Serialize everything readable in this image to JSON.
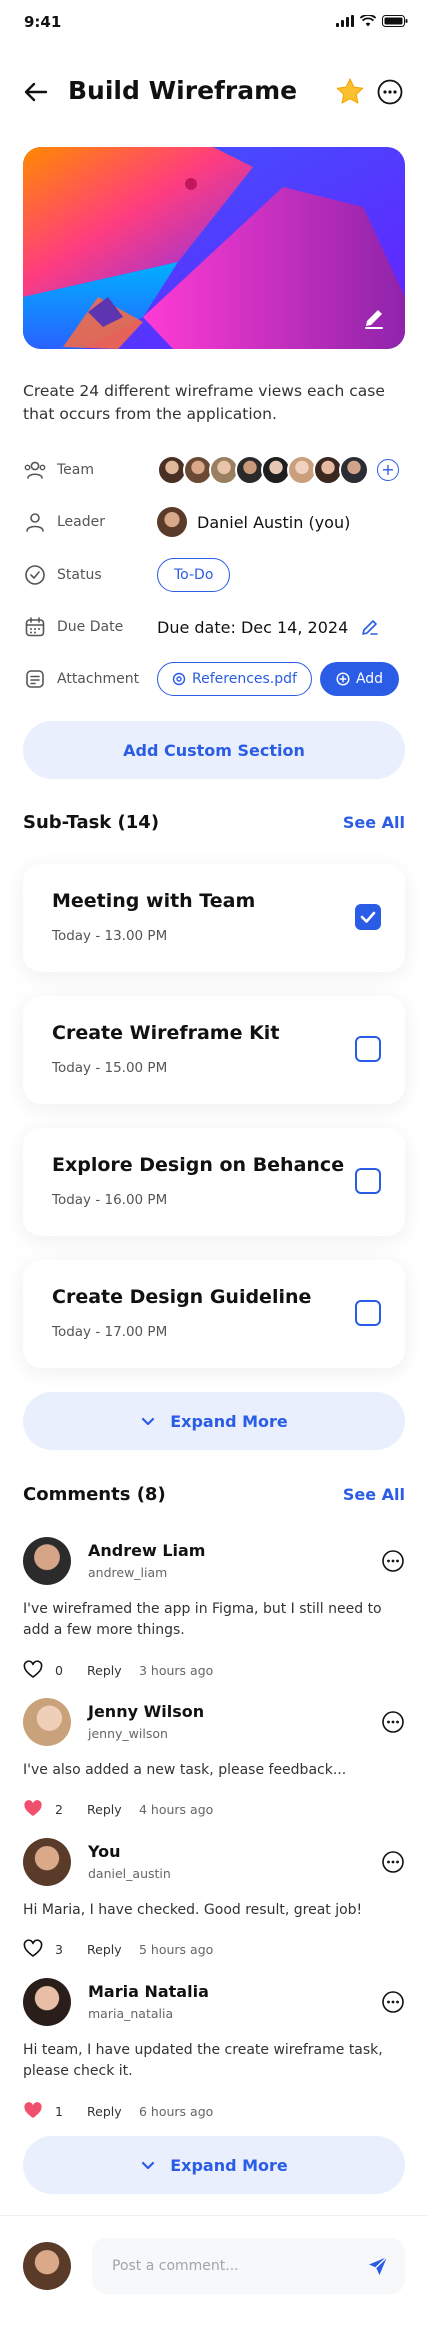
{
  "status_bar": {
    "time": "9:41"
  },
  "header": {
    "title": "Build Wireframe"
  },
  "description": "Create 24 different wireframe views each case that occurs from the application.",
  "details": {
    "team_label": "Team",
    "leader_label": "Leader",
    "leader_name": "Daniel Austin (you)",
    "status_label": "Status",
    "status_value": "To-Do",
    "due_label": "Due Date",
    "due_value": "Due date: Dec 14, 2024",
    "attachment_label": "Attachment",
    "attachment_file": "References.pdf",
    "attachment_add": "Add"
  },
  "add_section_label": "Add Custom Section",
  "subtasks": {
    "title": "Sub-Task (14)",
    "see_all": "See All",
    "items": [
      {
        "title": "Meeting with Team",
        "time": "Today - 13.00 PM",
        "checked": true
      },
      {
        "title": "Create Wireframe Kit",
        "time": "Today - 15.00 PM",
        "checked": false
      },
      {
        "title": "Explore Design on Behance",
        "time": "Today - 16.00 PM",
        "checked": false
      },
      {
        "title": "Create Design Guideline",
        "time": "Today - 17.00 PM",
        "checked": false
      }
    ],
    "expand_label": "Expand More"
  },
  "comments": {
    "title": "Comments (8)",
    "see_all": "See All",
    "items": [
      {
        "name": "Andrew Liam",
        "username": "andrew_liam",
        "text": "I've wireframed the app in Figma, but I still need to add a few more things.",
        "likes": "0",
        "liked": false,
        "reply": "Reply",
        "ago": "3 hours ago"
      },
      {
        "name": "Jenny Wilson",
        "username": "jenny_wilson",
        "text": "I've also added a new task, please feedback...",
        "likes": "2",
        "liked": true,
        "reply": "Reply",
        "ago": "4 hours ago"
      },
      {
        "name": "You",
        "username": "daniel_austin",
        "text": "Hi Maria, I have checked. Good result, great job!",
        "likes": "3",
        "liked": false,
        "reply": "Reply",
        "ago": "5 hours ago"
      },
      {
        "name": "Maria Natalia",
        "username": "maria_natalia",
        "text": "Hi team, I have updated the create wireframe task, please check it.",
        "likes": "1",
        "liked": true,
        "reply": "Reply",
        "ago": "6 hours ago"
      }
    ],
    "expand_label": "Expand More"
  },
  "composer": {
    "placeholder": "Post a comment..."
  },
  "colors": {
    "accent": "#2a5ce6",
    "soft_accent": "#e9effd",
    "heart": "#f0506e",
    "star": "#fbc02d"
  }
}
